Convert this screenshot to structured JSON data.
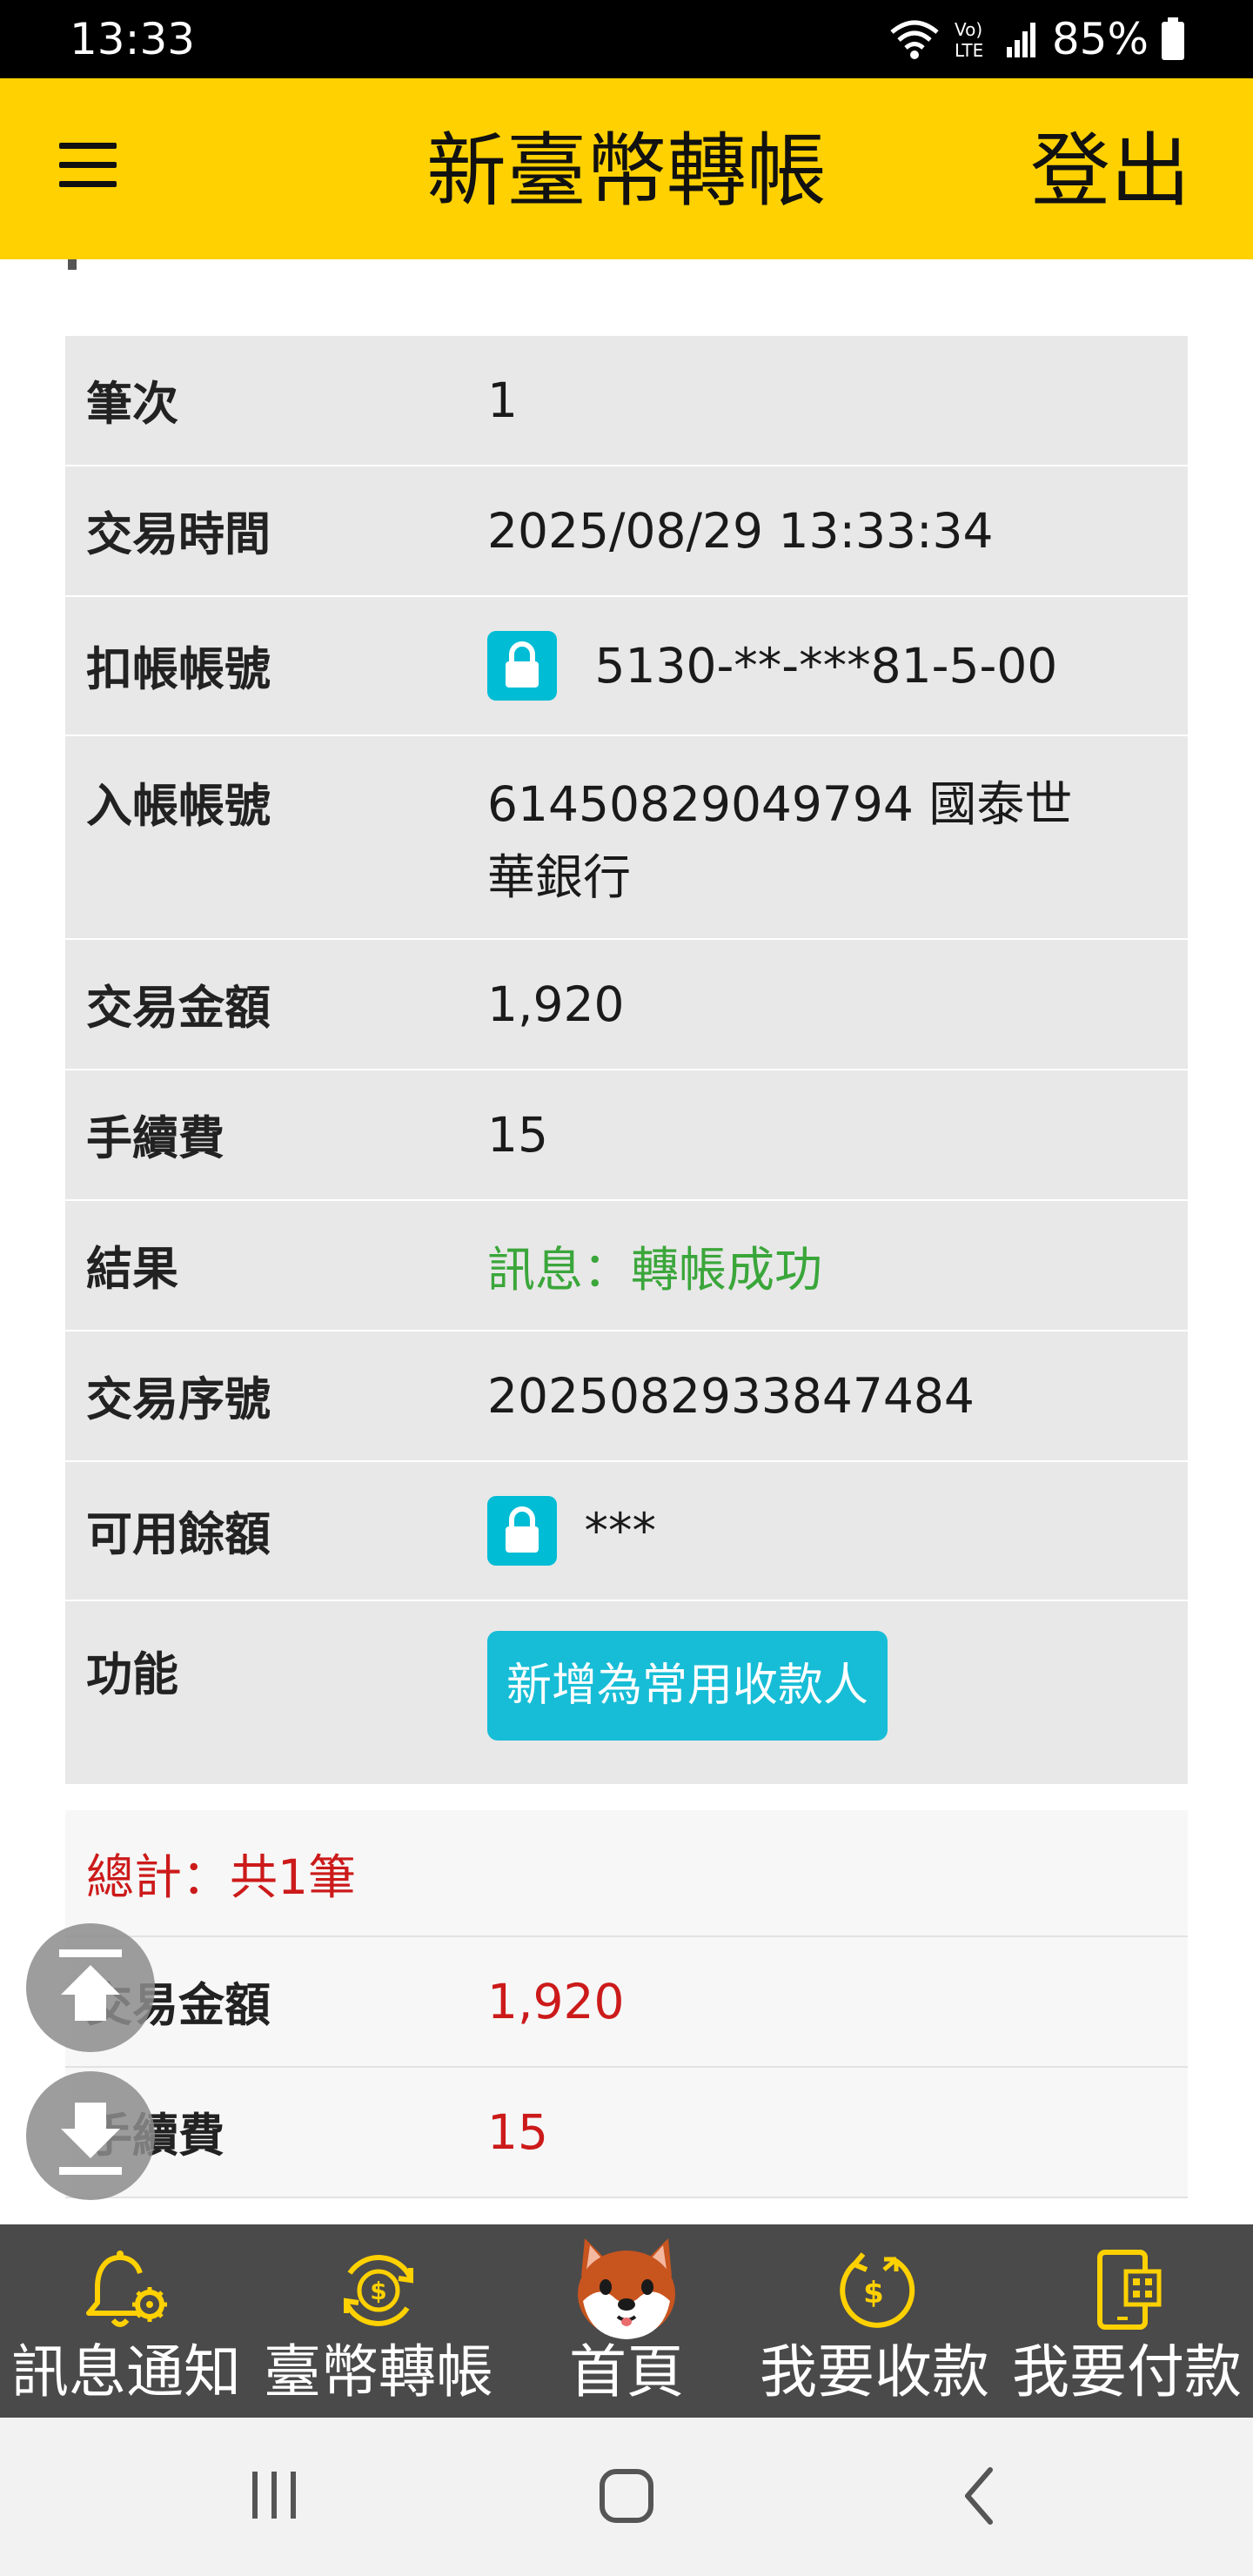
{
  "status_bar": {
    "time": "13:33",
    "signal_label": "Vo) LTE",
    "battery_pct": "85%"
  },
  "header": {
    "title": "新臺幣轉帳",
    "logout_label": "登出",
    "background_color": "#ffd100"
  },
  "detail": {
    "rows": [
      {
        "label": "筆次",
        "value": "1"
      },
      {
        "label": "交易時間",
        "value": "2025/08/29 13:33:34"
      },
      {
        "label": "扣帳帳號",
        "value": "5130-**-***81-5-00"
      },
      {
        "label": "入帳帳號",
        "value": "61450829049794 國泰世",
        "value_line2": "華銀行"
      },
      {
        "label": "交易金額",
        "value": "1,920"
      },
      {
        "label": "手續費",
        "value": "15"
      },
      {
        "label": "結果",
        "value": "訊息：轉帳成功"
      },
      {
        "label": "交易序號",
        "value": "2025082933847484"
      },
      {
        "label": "可用餘額",
        "value": "***"
      },
      {
        "label": "功能",
        "button_label": "新增為常用收款人"
      }
    ],
    "success_color": "#3aa63a",
    "accent_button_color": "#17bdd6"
  },
  "totals": {
    "heading": "總計：共1筆",
    "rows": [
      {
        "label": "交易金額",
        "value": "1,920"
      },
      {
        "label": "手續費",
        "value": "15"
      }
    ],
    "highlight_color": "#cc1a1a"
  },
  "bottom_nav": {
    "items": [
      {
        "label": "訊息通知",
        "icon": "bell-gear-icon"
      },
      {
        "label": "臺幣轉帳",
        "icon": "coin-transfer-icon"
      },
      {
        "label": "首頁",
        "icon": "shiba-dog-icon"
      },
      {
        "label": "我要收款",
        "icon": "receive-money-icon"
      },
      {
        "label": "我要付款",
        "icon": "phone-qr-pay-icon"
      }
    ]
  }
}
